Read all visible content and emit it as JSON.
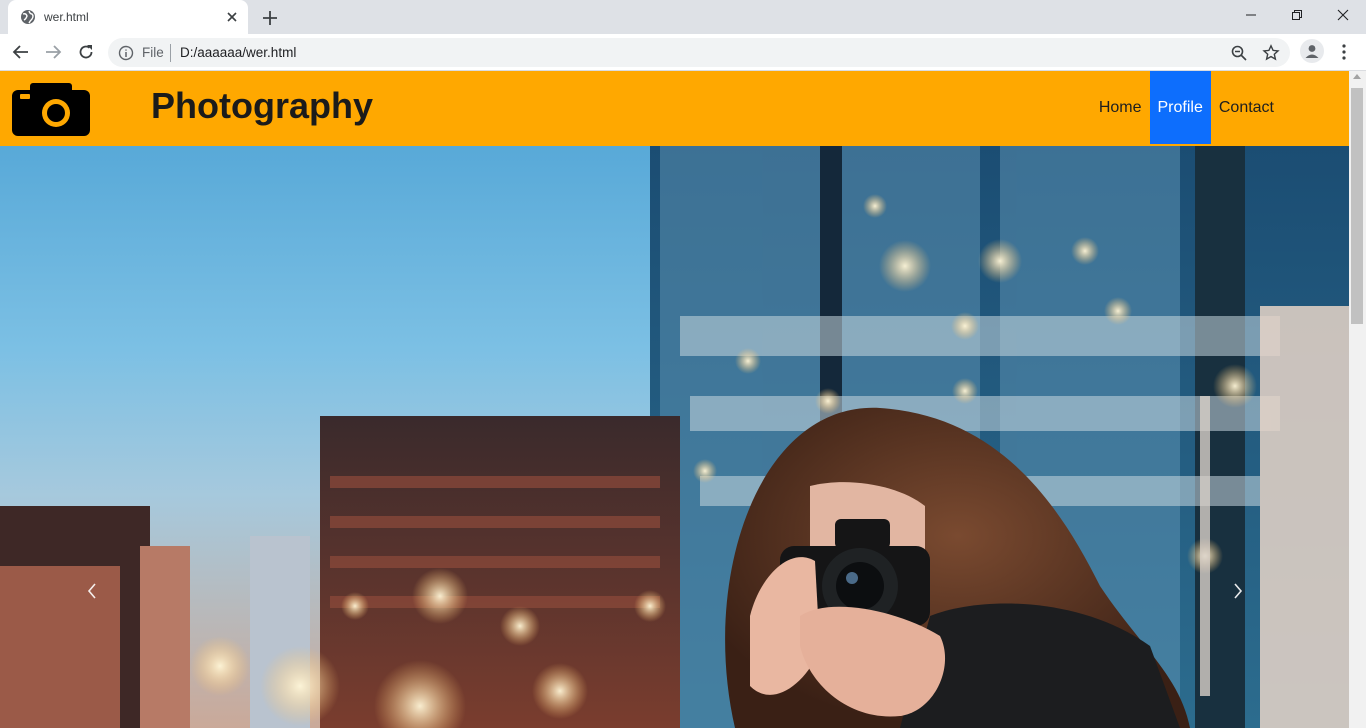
{
  "browser": {
    "tab_title": "wer.html",
    "scheme_label": "File",
    "url": "D:/aaaaaa/wer.html"
  },
  "site": {
    "brand": "Photography",
    "nav_items": [
      {
        "label": "Home",
        "active": false
      },
      {
        "label": "Profile",
        "active": true
      },
      {
        "label": "Contact",
        "active": false
      }
    ]
  },
  "colors": {
    "navbar": "#ffa800",
    "active_link": "#0d6efd",
    "brand_text": "#1b1b1b"
  },
  "hero": {
    "icon_prev": "chevron-left-icon",
    "icon_next": "chevron-right-icon"
  }
}
